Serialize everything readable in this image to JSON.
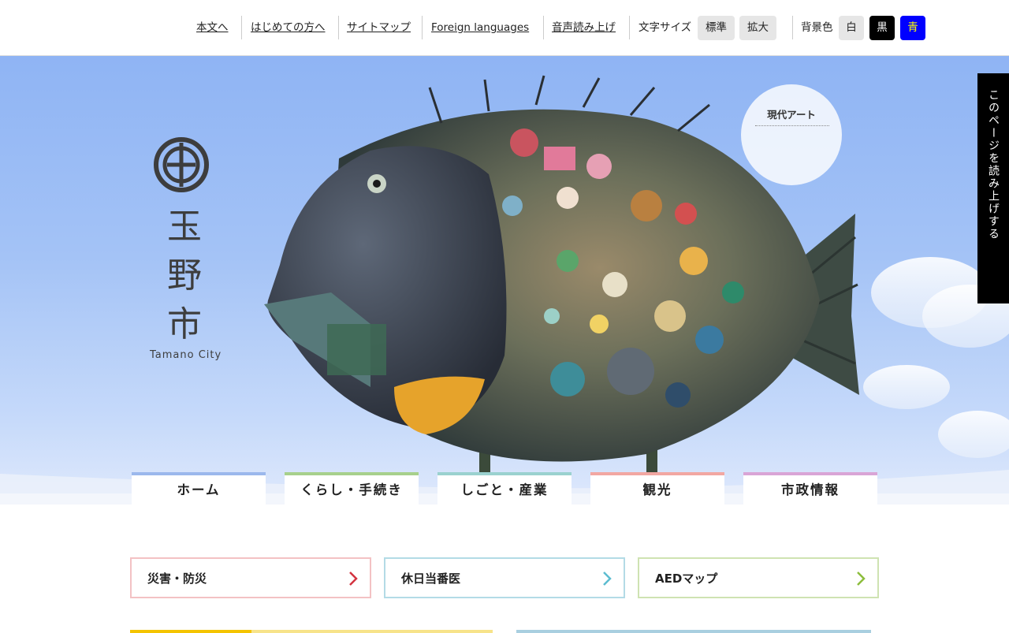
{
  "utility_nav": {
    "links": [
      "本文へ",
      "はじめての方へ",
      "サイトマップ",
      "Foreign languages",
      "音声読み上げ"
    ],
    "font_size_label": "文字サイズ",
    "font_size_buttons": [
      "標準",
      "拡大"
    ],
    "bg_color_label": "背景色",
    "bg_color_buttons": [
      "白",
      "黒",
      "青"
    ]
  },
  "logo": {
    "name_chars": [
      "玉",
      "野",
      "市"
    ],
    "subtitle": "Tamano City",
    "emblem_icon": "city-emblem-icon"
  },
  "hero": {
    "badge_text": "現代アート",
    "side_tab_text": "このページを読み上げする"
  },
  "global_nav": {
    "items": [
      {
        "label": "ホーム",
        "color": "#9bb8ec"
      },
      {
        "label": "くらし・手続き",
        "color": "#a7d08c"
      },
      {
        "label": "しごと・産業",
        "color": "#9ad1cf"
      },
      {
        "label": "観光",
        "color": "#f2a7a2"
      },
      {
        "label": "市政情報",
        "color": "#d9a5d6"
      }
    ]
  },
  "quick_links": [
    {
      "label": "災害・防災",
      "border_color": "#f3c2c4",
      "arrow_color": "#d33340",
      "icon": "chevron-right-icon"
    },
    {
      "label": "休日当番医",
      "border_color": "#b3dbe6",
      "arrow_color": "#5cbcd0",
      "icon": "chevron-right-icon"
    },
    {
      "label": "AEDマップ",
      "border_color": "#cfe3b2",
      "arrow_color": "#8cbd3c",
      "icon": "chevron-right-icon"
    }
  ],
  "colors": {
    "bg_black_button": "#000000",
    "bg_blue_button": "#0000ff",
    "bg_blue_button_text": "#ffff00"
  }
}
